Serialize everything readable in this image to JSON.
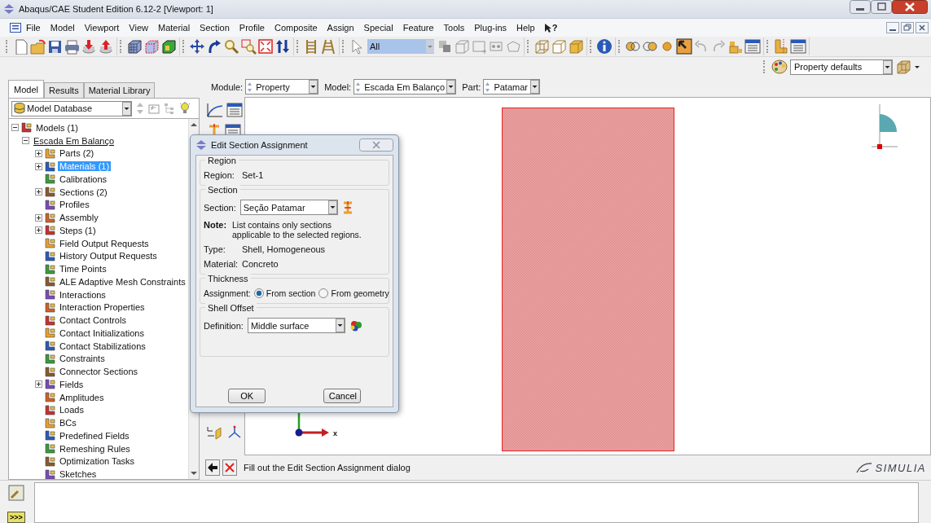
{
  "window": {
    "title": "Abaqus/CAE Student Edition 6.12-2 [Viewport: 1]"
  },
  "menu": [
    "File",
    "Model",
    "Viewport",
    "View",
    "Material",
    "Section",
    "Profile",
    "Composite",
    "Assign",
    "Special",
    "Feature",
    "Tools",
    "Plug-ins",
    "Help"
  ],
  "whats_this": "?",
  "toolbar": {
    "selection_filter": "All",
    "render_style": "Property defaults"
  },
  "left_tabs": [
    {
      "label": "Model",
      "selected": true
    },
    {
      "label": "Results",
      "selected": false
    },
    {
      "label": "Material Library",
      "selected": false
    }
  ],
  "database": "Model Database",
  "tree": [
    {
      "label": "Models (1)",
      "expanded": true,
      "selected": false,
      "children": [
        {
          "label": "Escada Em Balanço",
          "expanded": true,
          "selected": false,
          "current": true,
          "children": [
            {
              "label": "Parts (2)",
              "expanded": false,
              "selected": false
            },
            {
              "label": "Materials (1)",
              "expanded": false,
              "selected": true
            },
            {
              "label": "Calibrations",
              "selected": false
            },
            {
              "label": "Sections (2)",
              "expanded": false,
              "selected": false
            },
            {
              "label": "Profiles",
              "selected": false
            },
            {
              "label": "Assembly",
              "expanded": false,
              "selected": false
            },
            {
              "label": "Steps (1)",
              "expanded": false,
              "selected": false
            },
            {
              "label": "Field Output Requests",
              "selected": false
            },
            {
              "label": "History Output Requests",
              "selected": false
            },
            {
              "label": "Time Points",
              "selected": false
            },
            {
              "label": "ALE Adaptive Mesh Constraints",
              "selected": false
            },
            {
              "label": "Interactions",
              "selected": false
            },
            {
              "label": "Interaction Properties",
              "selected": false
            },
            {
              "label": "Contact Controls",
              "selected": false
            },
            {
              "label": "Contact Initializations",
              "selected": false
            },
            {
              "label": "Contact Stabilizations",
              "selected": false
            },
            {
              "label": "Constraints",
              "selected": false
            },
            {
              "label": "Connector Sections",
              "selected": false
            },
            {
              "label": "Fields",
              "expanded": false,
              "selected": false
            },
            {
              "label": "Amplitudes",
              "selected": false
            },
            {
              "label": "Loads",
              "selected": false
            },
            {
              "label": "BCs",
              "selected": false
            },
            {
              "label": "Predefined Fields",
              "selected": false
            },
            {
              "label": "Remeshing Rules",
              "selected": false
            },
            {
              "label": "Optimization Tasks",
              "selected": false
            },
            {
              "label": "Sketches",
              "selected": false
            }
          ]
        }
      ]
    }
  ],
  "context": [
    {
      "label": "Module:",
      "value": "Property"
    },
    {
      "label": "Model:",
      "value": "Escada Em Balanço"
    },
    {
      "label": "Part:",
      "value": "Patamar"
    }
  ],
  "dialog": {
    "title": "Edit Section Assignment",
    "groups": [
      {
        "title": "Region",
        "rows": [
          {
            "kind": "text",
            "label": "Region:",
            "value": "Set-1"
          }
        ]
      },
      {
        "title": "Section",
        "rows": [
          {
            "kind": "combo",
            "label": "Section:",
            "value": "Seção Patamar"
          },
          {
            "kind": "note",
            "label": "Note:",
            "value": "List contains only sections\napplicable to the selected regions."
          },
          {
            "kind": "text",
            "label": "Type:",
            "value": "Shell, Homogeneous"
          },
          {
            "kind": "text",
            "label": "Material:",
            "value": "Concreto"
          }
        ]
      },
      {
        "title": "Thickness",
        "rows": [
          {
            "kind": "radios",
            "label": "Assignment:",
            "options": [
              {
                "label": "From section",
                "selected": true
              },
              {
                "label": "From geometry",
                "selected": false
              }
            ]
          }
        ]
      },
      {
        "title": "Shell Offset",
        "rows": [
          {
            "kind": "combo",
            "label": "Definition:",
            "value": "Middle surface"
          }
        ]
      }
    ],
    "buttons": [
      "OK",
      "Cancel"
    ]
  },
  "viewport": {
    "axis_label": "x"
  },
  "prompt": "Fill out the Edit Section Assignment dialog",
  "brand": "SIMULIA",
  "console_button": ">>>"
}
